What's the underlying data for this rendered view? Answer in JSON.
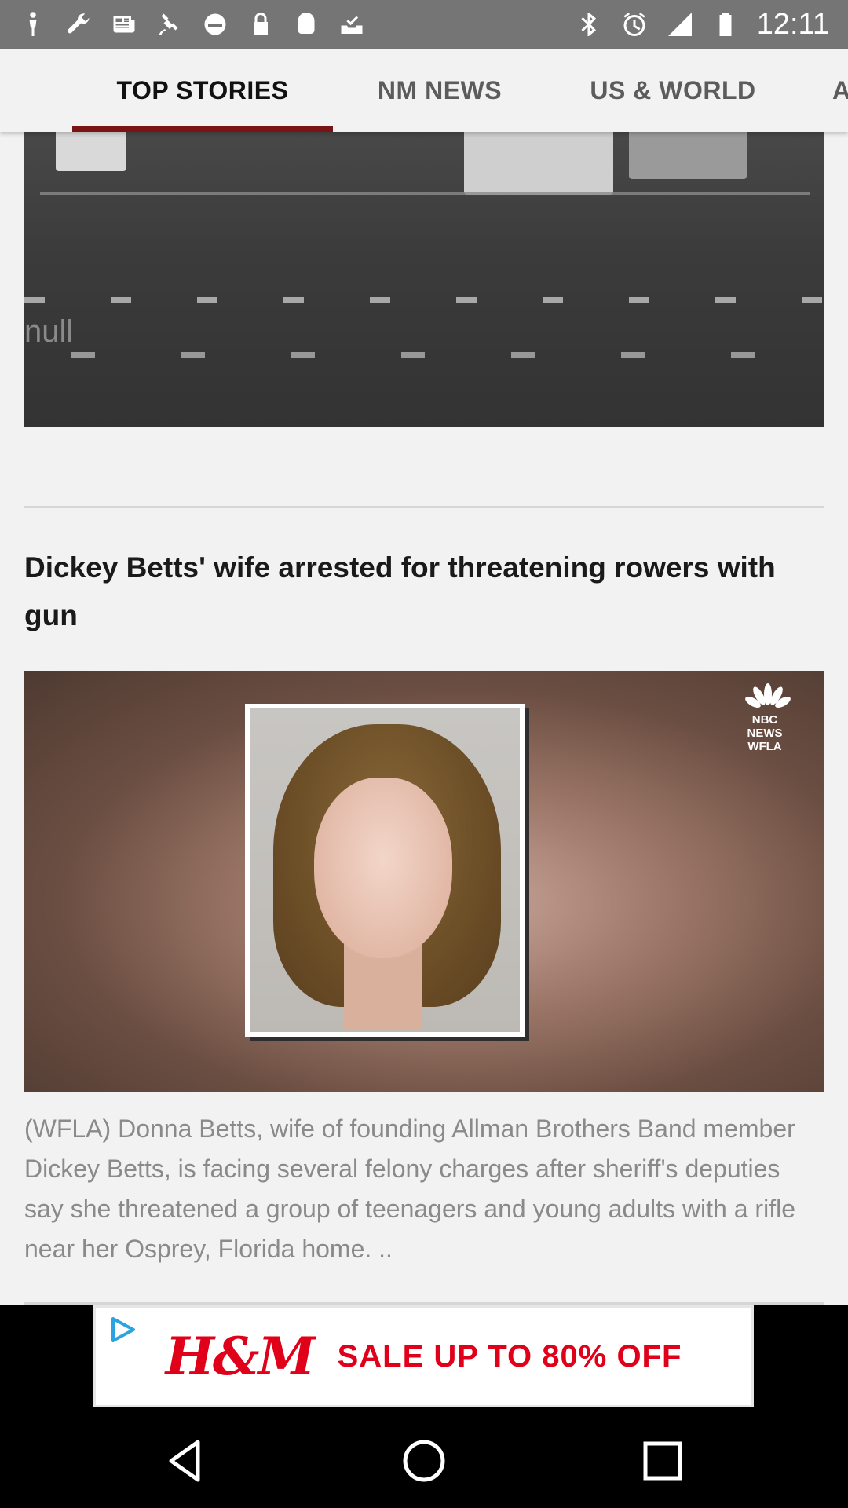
{
  "status_bar": {
    "time": "12:11",
    "icons_left": [
      "person-icon",
      "wrench-icon",
      "news-icon",
      "satellite-icon",
      "block-icon",
      "lock-icon",
      "android-icon",
      "inbox-check-icon"
    ],
    "icons_right": [
      "bluetooth-icon",
      "alarm-icon",
      "signal-icon",
      "battery-icon"
    ]
  },
  "tabs": [
    {
      "label": "TOP STORIES",
      "active": true
    },
    {
      "label": "NM NEWS",
      "active": false
    },
    {
      "label": "US & WORLD",
      "active": false
    },
    {
      "label": "A",
      "active": false
    }
  ],
  "feed": {
    "story1": {
      "title": "null"
    },
    "story2": {
      "headline": "Dickey Betts' wife arrested for threatening rowers with gun",
      "image_logo": "NBC NEWS WFLA",
      "summary": "(WFLA) Donna Betts, wife of founding Allman Brothers Band member Dickey Betts, is facing several felony charges after sheriff's deputies say she threatened a group of teenagers and young adults with a rifle near her Osprey, Florida home.   .."
    }
  },
  "ad": {
    "brand": "H&M",
    "text": "SALE UP TO 80% OFF",
    "brand_color": "#e0001a"
  },
  "nav": {
    "buttons": [
      "back-icon",
      "home-icon",
      "recents-icon"
    ]
  },
  "colors": {
    "status_bar": "#757575",
    "tab_indicator": "#7a1414",
    "background": "#f2f2f2"
  }
}
